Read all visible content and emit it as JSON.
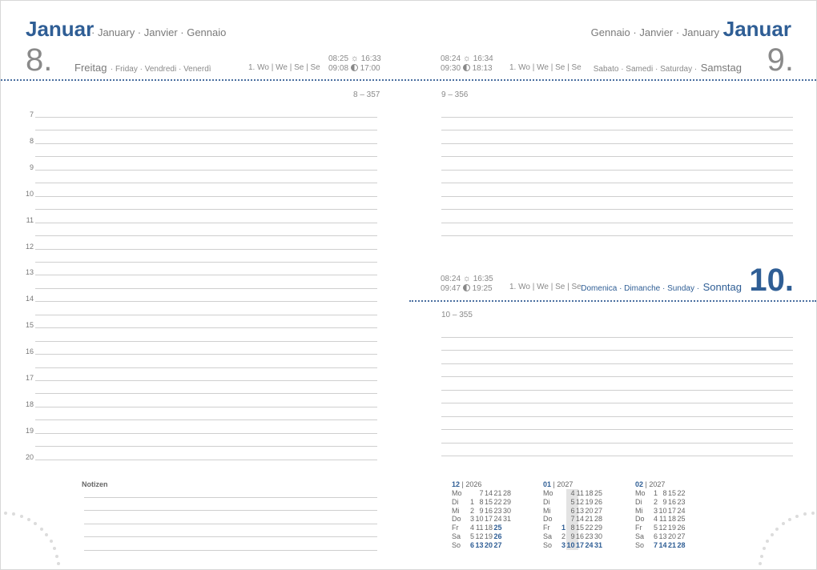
{
  "left_header": {
    "month": "Januar",
    "month_langs": "· January · Janvier · Gennaio",
    "day_number": "8.",
    "weekday": "Freitag",
    "weekday_langs": "· Friday · Vendredi · Venerdì",
    "week_info": "1. Wo | We | Se | Se",
    "sunrise": "08:25",
    "sunset": "16:33",
    "moonrise": "09:08",
    "moonset": "17:00",
    "day_count": "8 – 357"
  },
  "right_header": {
    "month": "Januar",
    "month_langs": "Gennaio · Janvier · January ·",
    "day_number": "9.",
    "weekday": "Samstag",
    "weekday_langs": "Sabato · Samedi · Saturday ·",
    "week_info": "1. Wo | We | Se | Se",
    "sunrise": "08:24",
    "sunset": "16:34",
    "moonrise": "09:30",
    "moonset": "18:13",
    "day_count": "9 – 356"
  },
  "sunday_header": {
    "day_number": "10.",
    "weekday": "Sonntag",
    "weekday_langs": "Domenica · Dimanche · Sunday ·",
    "week_info": "1. Wo | We | Se | Se",
    "sunrise": "08:24",
    "sunset": "16:35",
    "moonrise": "09:47",
    "moonset": "19:25",
    "day_count": "10 – 355"
  },
  "hours": [
    "7",
    "8",
    "9",
    "10",
    "11",
    "12",
    "13",
    "14",
    "15",
    "16",
    "17",
    "18",
    "19",
    "20"
  ],
  "notes_label": "Notizen",
  "mini_calendars": [
    {
      "month": "12",
      "year": "2026",
      "day_labels": [
        "Mo",
        "Di",
        "Mi",
        "Do",
        "Fr",
        "Sa",
        "So"
      ],
      "rows": [
        [
          "",
          "7",
          "14",
          "21",
          "28"
        ],
        [
          "1",
          "8",
          "15",
          "22",
          "29"
        ],
        [
          "2",
          "9",
          "16",
          "23",
          "30"
        ],
        [
          "3",
          "10",
          "17",
          "24",
          "31"
        ],
        [
          "4",
          "11",
          "18",
          "25",
          ""
        ],
        [
          "5",
          "12",
          "19",
          "26",
          ""
        ],
        [
          "6",
          "13",
          "20",
          "27",
          ""
        ]
      ],
      "bold_sat": [
        3
      ],
      "bold_fri": [
        3
      ]
    },
    {
      "month": "01",
      "year": "2027",
      "day_labels": [
        "Mo",
        "Di",
        "Mi",
        "Do",
        "Fr",
        "Sa",
        "So"
      ],
      "rows": [
        [
          "",
          "4",
          "11",
          "18",
          "25"
        ],
        [
          "",
          "5",
          "12",
          "19",
          "26"
        ],
        [
          "",
          "6",
          "13",
          "20",
          "27"
        ],
        [
          "",
          "7",
          "14",
          "21",
          "28"
        ],
        [
          "1",
          "8",
          "15",
          "22",
          "29"
        ],
        [
          "2",
          "9",
          "16",
          "23",
          "30"
        ],
        [
          "3",
          "10",
          "17",
          "24",
          "31"
        ]
      ],
      "bold_sat": [],
      "bold_fri": [
        0
      ]
    },
    {
      "month": "02",
      "year": "2027",
      "day_labels": [
        "Mo",
        "Di",
        "Mi",
        "Do",
        "Fr",
        "Sa",
        "So"
      ],
      "rows": [
        [
          "1",
          "8",
          "15",
          "22"
        ],
        [
          "2",
          "9",
          "16",
          "23"
        ],
        [
          "3",
          "10",
          "17",
          "24"
        ],
        [
          "4",
          "11",
          "18",
          "25"
        ],
        [
          "5",
          "12",
          "19",
          "26"
        ],
        [
          "6",
          "13",
          "20",
          "27"
        ],
        [
          "7",
          "14",
          "21",
          "28"
        ]
      ],
      "bold_sat": [],
      "bold_fri": []
    }
  ]
}
